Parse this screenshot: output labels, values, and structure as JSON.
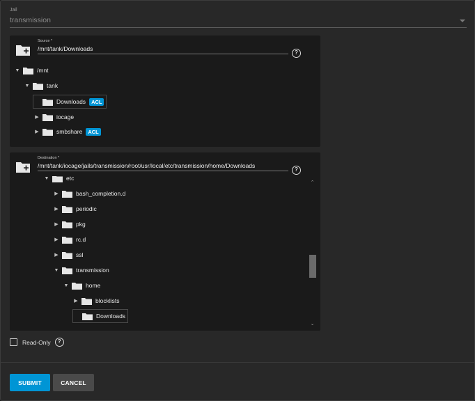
{
  "jail": {
    "label": "Jail",
    "value": "transmission"
  },
  "source": {
    "label": "Source *",
    "value": "/mnt/tank/Downloads",
    "tree": [
      {
        "name": "/mnt",
        "toggle": "▼"
      },
      {
        "name": "tank",
        "toggle": "▼"
      },
      {
        "name": "Downloads",
        "toggle": "",
        "badge": "ACL"
      },
      {
        "name": "iocage",
        "toggle": "▶"
      },
      {
        "name": "smbshare",
        "toggle": "▶",
        "badge": "ACL"
      }
    ]
  },
  "destination": {
    "label": "Destination *",
    "value": "/mnt/tank/iocage/jails/transmission/root/usr/local/etc/transmission/home/Downloads",
    "tree": [
      {
        "name": "etc",
        "toggle": "▼"
      },
      {
        "name": "bash_completion.d",
        "toggle": "▶"
      },
      {
        "name": "periodic",
        "toggle": "▶"
      },
      {
        "name": "pkg",
        "toggle": "▶"
      },
      {
        "name": "rc.d",
        "toggle": "▶"
      },
      {
        "name": "ssl",
        "toggle": "▶"
      },
      {
        "name": "transmission",
        "toggle": "▼"
      },
      {
        "name": "home",
        "toggle": "▼"
      },
      {
        "name": "blocklists",
        "toggle": "▶"
      },
      {
        "name": "Downloads",
        "toggle": ""
      }
    ]
  },
  "readonly": {
    "label": "Read-Only"
  },
  "help_glyph": "?",
  "buttons": {
    "submit": "SUBMIT",
    "cancel": "CANCEL"
  },
  "colors": {
    "accent": "#0095d5",
    "panel": "#1a1a1a",
    "background": "#282828"
  }
}
